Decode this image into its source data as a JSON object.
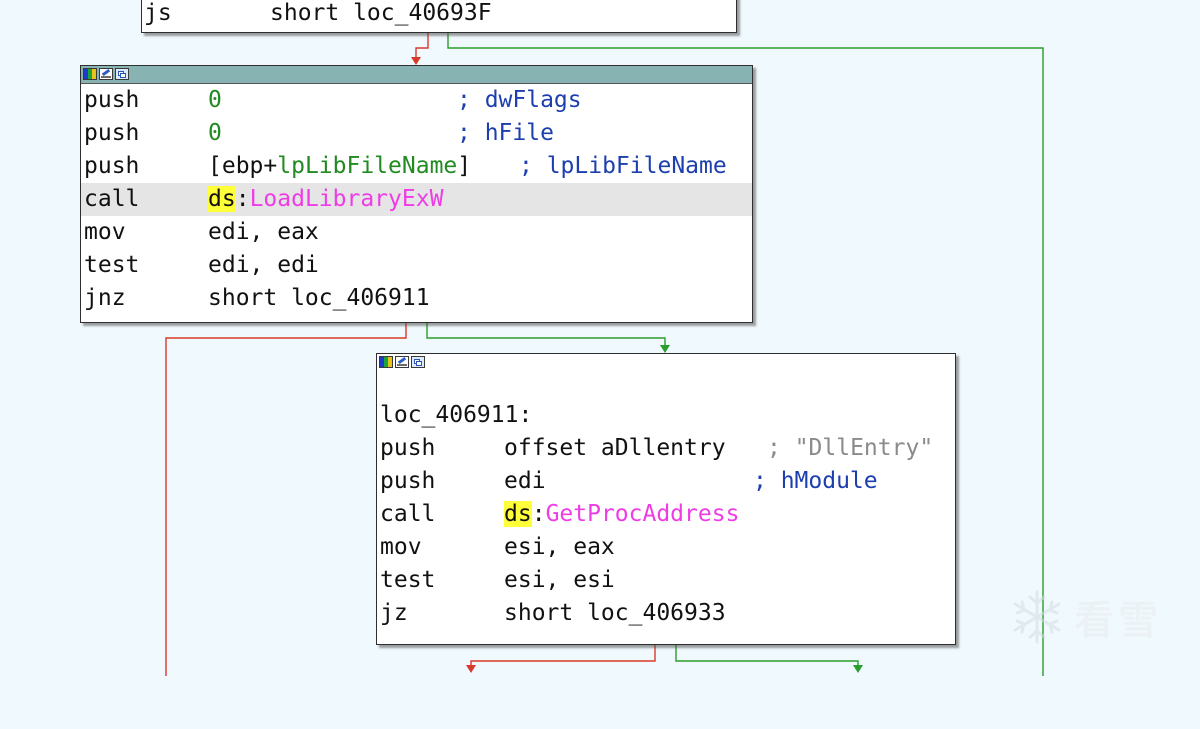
{
  "edge_colors": {
    "true_branch": "#2a9d2a",
    "false_branch": "#d83a2a"
  },
  "top_block": {
    "lines": [
      {
        "mnemonic": "js",
        "operand": "short loc_40693F"
      }
    ]
  },
  "block_load_library": {
    "header_icons": [
      "node-color-icon",
      "edit-node-icon",
      "graph-overview-icon"
    ],
    "lines": [
      {
        "mnemonic": "push",
        "operand": "0",
        "comment": "; dwFlags"
      },
      {
        "mnemonic": "push",
        "operand": "0",
        "comment": "; hFile"
      },
      {
        "mnemonic": "push",
        "operand_open": "[ebp+",
        "operand_var": "lpLibFileName",
        "operand_close": "]",
        "comment": "; lpLibFileName"
      },
      {
        "mnemonic": "call",
        "seg": "ds",
        "sep": ":",
        "api": "LoadLibraryExW"
      },
      {
        "mnemonic": "mov",
        "operand": "edi, eax"
      },
      {
        "mnemonic": "test",
        "operand": "edi, edi"
      },
      {
        "mnemonic": "jnz",
        "operand": "short loc_406911"
      }
    ]
  },
  "block_get_proc_address": {
    "header_icons": [
      "node-color-icon",
      "edit-node-icon",
      "graph-overview-icon"
    ],
    "label": "loc_406911:",
    "lines": [
      {
        "mnemonic": "push",
        "operand": "offset aDllentry",
        "comment": "; \"DllEntry\""
      },
      {
        "mnemonic": "push",
        "operand": "edi",
        "comment": "; hModule"
      },
      {
        "mnemonic": "call",
        "seg": "ds",
        "sep": ":",
        "api": "GetProcAddress"
      },
      {
        "mnemonic": "mov",
        "operand": "esi, eax"
      },
      {
        "mnemonic": "test",
        "operand": "esi, esi"
      },
      {
        "mnemonic": "jz",
        "operand": "short loc_406933"
      }
    ]
  },
  "watermark": {
    "icon": "snowflake-icon",
    "text": "看雪"
  }
}
